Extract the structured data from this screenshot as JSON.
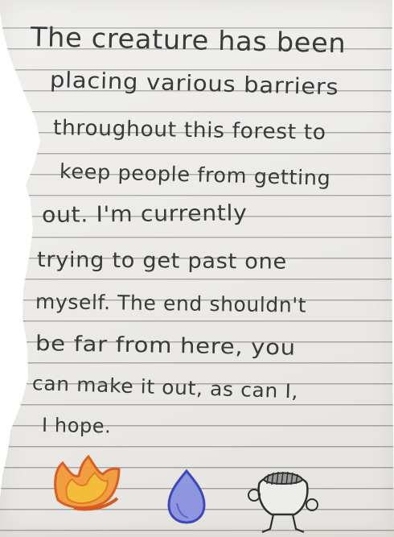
{
  "note": {
    "lines": [
      "The creature has been",
      "placing various barriers",
      "throughout this forest to",
      "keep people from getting",
      "out. I'm currently",
      "trying to get past one",
      "myself. The end shouldn't",
      "be far from here, you",
      "can make it out, as can I,",
      "I hope."
    ]
  },
  "drawings": [
    {
      "icon": "orange-flame-icon",
      "colors": [
        "#e06a1c",
        "#f2c230"
      ]
    },
    {
      "icon": "blue-drop-icon",
      "colors": [
        "#4a55c8"
      ]
    },
    {
      "icon": "pot-creature-icon",
      "colors": [
        "#333333"
      ]
    }
  ]
}
